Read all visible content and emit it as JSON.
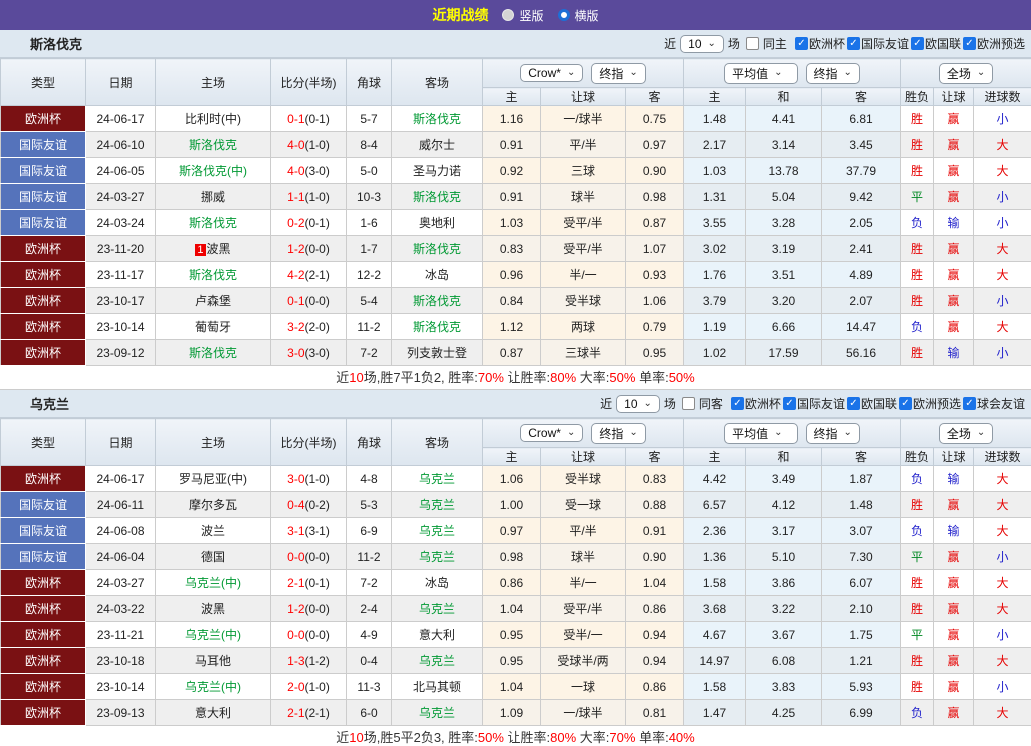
{
  "topbar": {
    "title": "近期战绩",
    "radio_vertical": "竖版",
    "radio_horizontal": "横版"
  },
  "colors": {
    "purple": "#5a4a9b",
    "title_yellow": "#ffff00",
    "team_green": "#009933",
    "score_red": "#ff0000",
    "checkbox_blue": "#1a73e8",
    "competition": {
      "欧洲杯": "#7a1113",
      "国际友谊": "#5573bb"
    },
    "result": {
      "胜": "#e60000",
      "平": "#008822",
      "负": "#2222cc",
      "赢": "#e60000",
      "输": "#2222cc",
      "大": "#e60000",
      "小": "#2222cc"
    }
  },
  "grid": {
    "col_type": "类型",
    "col_date": "日期",
    "col_home": "主场",
    "col_score": "比分(半场)",
    "col_corner": "角球",
    "col_away": "客场",
    "bookmaker": "Crow*",
    "final1": "终指",
    "average": "平均值",
    "final2": "终指",
    "period": "全场",
    "sub": [
      "主",
      "让球",
      "客",
      "主",
      "和",
      "客",
      "胜负",
      "让球",
      "进球数"
    ]
  },
  "sections": [
    {
      "team": "斯洛伐克",
      "filter": {
        "near_label": "近",
        "count": "10",
        "games_label": "场",
        "same_label": "同主",
        "same_checked": false,
        "competitions": [
          {
            "label": "欧洲杯",
            "checked": true
          },
          {
            "label": "国际友谊",
            "checked": true
          },
          {
            "label": "欧国联",
            "checked": true
          },
          {
            "label": "欧洲预选",
            "checked": true
          }
        ]
      },
      "rows": [
        {
          "type": "欧洲杯",
          "date": "24-06-17",
          "home": "比利时(中)",
          "homeGreen": false,
          "score": "0-1",
          "half": "(0-1)",
          "corner": "5-7",
          "away": "斯洛伐克",
          "awayGreen": true,
          "o1": "1.16",
          "hc": "一/球半",
          "o2": "0.75",
          "a1": "1.48",
          "a2": "4.41",
          "a3": "6.81",
          "r": [
            "胜",
            "赢",
            "小"
          ]
        },
        {
          "type": "国际友谊",
          "date": "24-06-10",
          "home": "斯洛伐克",
          "homeGreen": true,
          "score": "4-0",
          "half": "(1-0)",
          "corner": "8-4",
          "away": "威尔士",
          "awayGreen": false,
          "o1": "0.91",
          "hc": "平/半",
          "o2": "0.97",
          "a1": "2.17",
          "a2": "3.14",
          "a3": "3.45",
          "r": [
            "胜",
            "赢",
            "大"
          ]
        },
        {
          "type": "国际友谊",
          "date": "24-06-05",
          "home": "斯洛伐克(中)",
          "homeGreen": true,
          "score": "4-0",
          "half": "(3-0)",
          "corner": "5-0",
          "away": "圣马力诺",
          "awayGreen": false,
          "o1": "0.92",
          "hc": "三球",
          "o2": "0.90",
          "a1": "1.03",
          "a2": "13.78",
          "a3": "37.79",
          "r": [
            "胜",
            "赢",
            "大"
          ]
        },
        {
          "type": "国际友谊",
          "date": "24-03-27",
          "home": "挪威",
          "homeGreen": false,
          "score": "1-1",
          "half": "(1-0)",
          "corner": "10-3",
          "away": "斯洛伐克",
          "awayGreen": true,
          "o1": "0.91",
          "hc": "球半",
          "o2": "0.98",
          "a1": "1.31",
          "a2": "5.04",
          "a3": "9.42",
          "r": [
            "平",
            "赢",
            "小"
          ]
        },
        {
          "type": "国际友谊",
          "date": "24-03-24",
          "home": "斯洛伐克",
          "homeGreen": true,
          "score": "0-2",
          "half": "(0-1)",
          "corner": "1-6",
          "away": "奥地利",
          "awayGreen": false,
          "o1": "1.03",
          "hc": "受平/半",
          "o2": "0.87",
          "a1": "3.55",
          "a2": "3.28",
          "a3": "2.05",
          "r": [
            "负",
            "输",
            "小"
          ]
        },
        {
          "type": "欧洲杯",
          "date": "23-11-20",
          "homeBadge": "1",
          "home": "波黑",
          "homeGreen": false,
          "score": "1-2",
          "half": "(0-0)",
          "corner": "1-7",
          "away": "斯洛伐克",
          "awayGreen": true,
          "o1": "0.83",
          "hc": "受平/半",
          "o2": "1.07",
          "a1": "3.02",
          "a2": "3.19",
          "a3": "2.41",
          "r": [
            "胜",
            "赢",
            "大"
          ]
        },
        {
          "type": "欧洲杯",
          "date": "23-11-17",
          "home": "斯洛伐克",
          "homeGreen": true,
          "score": "4-2",
          "half": "(2-1)",
          "corner": "12-2",
          "away": "冰岛",
          "awayGreen": false,
          "o1": "0.96",
          "hc": "半/一",
          "o2": "0.93",
          "a1": "1.76",
          "a2": "3.51",
          "a3": "4.89",
          "r": [
            "胜",
            "赢",
            "大"
          ]
        },
        {
          "type": "欧洲杯",
          "date": "23-10-17",
          "home": "卢森堡",
          "homeGreen": false,
          "score": "0-1",
          "half": "(0-0)",
          "corner": "5-4",
          "away": "斯洛伐克",
          "awayGreen": true,
          "o1": "0.84",
          "hc": "受半球",
          "o2": "1.06",
          "a1": "3.79",
          "a2": "3.20",
          "a3": "2.07",
          "r": [
            "胜",
            "赢",
            "小"
          ]
        },
        {
          "type": "欧洲杯",
          "date": "23-10-14",
          "home": "葡萄牙",
          "homeGreen": false,
          "score": "3-2",
          "half": "(2-0)",
          "corner": "11-2",
          "away": "斯洛伐克",
          "awayGreen": true,
          "o1": "1.12",
          "hc": "两球",
          "o2": "0.79",
          "a1": "1.19",
          "a2": "6.66",
          "a3": "14.47",
          "r": [
            "负",
            "赢",
            "大"
          ]
        },
        {
          "type": "欧洲杯",
          "date": "23-09-12",
          "home": "斯洛伐克",
          "homeGreen": true,
          "score": "3-0",
          "half": "(3-0)",
          "corner": "7-2",
          "away": "列支敦士登",
          "awayGreen": false,
          "o1": "0.87",
          "hc": "三球半",
          "o2": "0.95",
          "a1": "1.02",
          "a2": "17.59",
          "a3": "56.16",
          "r": [
            "胜",
            "输",
            "小"
          ]
        }
      ],
      "summary": [
        {
          "text": "近",
          "red": false
        },
        {
          "text": "10",
          "red": true
        },
        {
          "text": "场,胜7平1负2, 胜率:",
          "red": false
        },
        {
          "text": "70%",
          "red": true
        },
        {
          "text": " 让胜率:",
          "red": false
        },
        {
          "text": "80%",
          "red": true
        },
        {
          "text": " 大率:",
          "red": false
        },
        {
          "text": "50%",
          "red": true
        },
        {
          "text": " 单率:",
          "red": false
        },
        {
          "text": "50%",
          "red": true
        }
      ]
    },
    {
      "team": "乌克兰",
      "filter": {
        "near_label": "近",
        "count": "10",
        "games_label": "场",
        "same_label": "同客",
        "same_checked": false,
        "competitions": [
          {
            "label": "欧洲杯",
            "checked": true
          },
          {
            "label": "国际友谊",
            "checked": true
          },
          {
            "label": "欧国联",
            "checked": true
          },
          {
            "label": "欧洲预选",
            "checked": true
          },
          {
            "label": "球会友谊",
            "checked": true
          }
        ]
      },
      "rows": [
        {
          "type": "欧洲杯",
          "date": "24-06-17",
          "home": "罗马尼亚(中)",
          "homeGreen": false,
          "score": "3-0",
          "half": "(1-0)",
          "corner": "4-8",
          "away": "乌克兰",
          "awayGreen": true,
          "o1": "1.06",
          "hc": "受半球",
          "o2": "0.83",
          "a1": "4.42",
          "a2": "3.49",
          "a3": "1.87",
          "r": [
            "负",
            "输",
            "大"
          ]
        },
        {
          "type": "国际友谊",
          "date": "24-06-11",
          "home": "摩尔多瓦",
          "homeGreen": false,
          "score": "0-4",
          "half": "(0-2)",
          "corner": "5-3",
          "away": "乌克兰",
          "awayGreen": true,
          "o1": "1.00",
          "hc": "受一球",
          "o2": "0.88",
          "a1": "6.57",
          "a2": "4.12",
          "a3": "1.48",
          "r": [
            "胜",
            "赢",
            "大"
          ]
        },
        {
          "type": "国际友谊",
          "date": "24-06-08",
          "home": "波兰",
          "homeGreen": false,
          "score": "3-1",
          "half": "(3-1)",
          "corner": "6-9",
          "away": "乌克兰",
          "awayGreen": true,
          "o1": "0.97",
          "hc": "平/半",
          "o2": "0.91",
          "a1": "2.36",
          "a2": "3.17",
          "a3": "3.07",
          "r": [
            "负",
            "输",
            "大"
          ]
        },
        {
          "type": "国际友谊",
          "date": "24-06-04",
          "home": "德国",
          "homeGreen": false,
          "score": "0-0",
          "half": "(0-0)",
          "corner": "11-2",
          "away": "乌克兰",
          "awayGreen": true,
          "o1": "0.98",
          "hc": "球半",
          "o2": "0.90",
          "a1": "1.36",
          "a2": "5.10",
          "a3": "7.30",
          "r": [
            "平",
            "赢",
            "小"
          ]
        },
        {
          "type": "欧洲杯",
          "date": "24-03-27",
          "home": "乌克兰(中)",
          "homeGreen": true,
          "score": "2-1",
          "half": "(0-1)",
          "corner": "7-2",
          "away": "冰岛",
          "awayGreen": false,
          "o1": "0.86",
          "hc": "半/一",
          "o2": "1.04",
          "a1": "1.58",
          "a2": "3.86",
          "a3": "6.07",
          "r": [
            "胜",
            "赢",
            "大"
          ]
        },
        {
          "type": "欧洲杯",
          "date": "24-03-22",
          "home": "波黑",
          "homeGreen": false,
          "score": "1-2",
          "half": "(0-0)",
          "corner": "2-4",
          "away": "乌克兰",
          "awayGreen": true,
          "o1": "1.04",
          "hc": "受平/半",
          "o2": "0.86",
          "a1": "3.68",
          "a2": "3.22",
          "a3": "2.10",
          "r": [
            "胜",
            "赢",
            "大"
          ]
        },
        {
          "type": "欧洲杯",
          "date": "23-11-21",
          "home": "乌克兰(中)",
          "homeGreen": true,
          "score": "0-0",
          "half": "(0-0)",
          "corner": "4-9",
          "away": "意大利",
          "awayGreen": false,
          "o1": "0.95",
          "hc": "受半/一",
          "o2": "0.94",
          "a1": "4.67",
          "a2": "3.67",
          "a3": "1.75",
          "r": [
            "平",
            "赢",
            "小"
          ]
        },
        {
          "type": "欧洲杯",
          "date": "23-10-18",
          "home": "马耳他",
          "homeGreen": false,
          "score": "1-3",
          "half": "(1-2)",
          "corner": "0-4",
          "away": "乌克兰",
          "awayGreen": true,
          "o1": "0.95",
          "hc": "受球半/两",
          "o2": "0.94",
          "a1": "14.97",
          "a2": "6.08",
          "a3": "1.21",
          "r": [
            "胜",
            "赢",
            "大"
          ]
        },
        {
          "type": "欧洲杯",
          "date": "23-10-14",
          "home": "乌克兰(中)",
          "homeGreen": true,
          "score": "2-0",
          "half": "(1-0)",
          "corner": "11-3",
          "away": "北马其顿",
          "awayGreen": false,
          "o1": "1.04",
          "hc": "一球",
          "o2": "0.86",
          "a1": "1.58",
          "a2": "3.83",
          "a3": "5.93",
          "r": [
            "胜",
            "赢",
            "小"
          ]
        },
        {
          "type": "欧洲杯",
          "date": "23-09-13",
          "home": "意大利",
          "homeGreen": false,
          "score": "2-1",
          "half": "(2-1)",
          "corner": "6-0",
          "away": "乌克兰",
          "awayGreen": true,
          "o1": "1.09",
          "hc": "一/球半",
          "o2": "0.81",
          "a1": "1.47",
          "a2": "4.25",
          "a3": "6.99",
          "r": [
            "负",
            "赢",
            "大"
          ]
        }
      ],
      "summary": [
        {
          "text": "近",
          "red": false
        },
        {
          "text": "10",
          "red": true
        },
        {
          "text": "场,胜5平2负3, 胜率:",
          "red": false
        },
        {
          "text": "50%",
          "red": true
        },
        {
          "text": " 让胜率:",
          "red": false
        },
        {
          "text": "80%",
          "red": true
        },
        {
          "text": " 大率:",
          "red": false
        },
        {
          "text": "70%",
          "red": true
        },
        {
          "text": " 单率:",
          "red": false
        },
        {
          "text": "40%",
          "red": true
        }
      ]
    }
  ]
}
